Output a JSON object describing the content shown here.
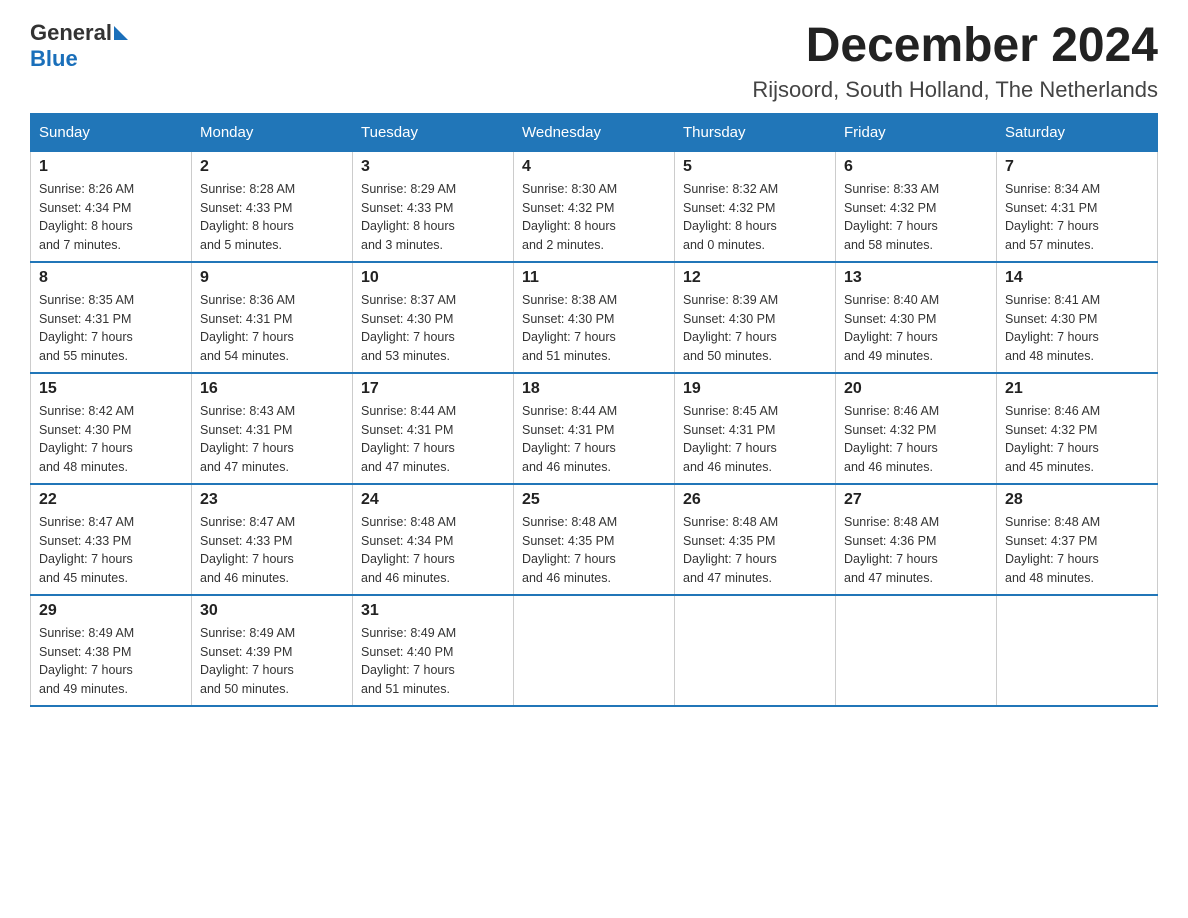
{
  "header": {
    "logo_text_general": "General",
    "logo_text_blue": "Blue",
    "month_title": "December 2024",
    "location": "Rijsoord, South Holland, The Netherlands"
  },
  "days_of_week": [
    "Sunday",
    "Monday",
    "Tuesday",
    "Wednesday",
    "Thursday",
    "Friday",
    "Saturday"
  ],
  "weeks": [
    [
      {
        "day": "1",
        "sunrise": "8:26 AM",
        "sunset": "4:34 PM",
        "daylight": "8 hours and 7 minutes."
      },
      {
        "day": "2",
        "sunrise": "8:28 AM",
        "sunset": "4:33 PM",
        "daylight": "8 hours and 5 minutes."
      },
      {
        "day": "3",
        "sunrise": "8:29 AM",
        "sunset": "4:33 PM",
        "daylight": "8 hours and 3 minutes."
      },
      {
        "day": "4",
        "sunrise": "8:30 AM",
        "sunset": "4:32 PM",
        "daylight": "8 hours and 2 minutes."
      },
      {
        "day": "5",
        "sunrise": "8:32 AM",
        "sunset": "4:32 PM",
        "daylight": "8 hours and 0 minutes."
      },
      {
        "day": "6",
        "sunrise": "8:33 AM",
        "sunset": "4:32 PM",
        "daylight": "7 hours and 58 minutes."
      },
      {
        "day": "7",
        "sunrise": "8:34 AM",
        "sunset": "4:31 PM",
        "daylight": "7 hours and 57 minutes."
      }
    ],
    [
      {
        "day": "8",
        "sunrise": "8:35 AM",
        "sunset": "4:31 PM",
        "daylight": "7 hours and 55 minutes."
      },
      {
        "day": "9",
        "sunrise": "8:36 AM",
        "sunset": "4:31 PM",
        "daylight": "7 hours and 54 minutes."
      },
      {
        "day": "10",
        "sunrise": "8:37 AM",
        "sunset": "4:30 PM",
        "daylight": "7 hours and 53 minutes."
      },
      {
        "day": "11",
        "sunrise": "8:38 AM",
        "sunset": "4:30 PM",
        "daylight": "7 hours and 51 minutes."
      },
      {
        "day": "12",
        "sunrise": "8:39 AM",
        "sunset": "4:30 PM",
        "daylight": "7 hours and 50 minutes."
      },
      {
        "day": "13",
        "sunrise": "8:40 AM",
        "sunset": "4:30 PM",
        "daylight": "7 hours and 49 minutes."
      },
      {
        "day": "14",
        "sunrise": "8:41 AM",
        "sunset": "4:30 PM",
        "daylight": "7 hours and 48 minutes."
      }
    ],
    [
      {
        "day": "15",
        "sunrise": "8:42 AM",
        "sunset": "4:30 PM",
        "daylight": "7 hours and 48 minutes."
      },
      {
        "day": "16",
        "sunrise": "8:43 AM",
        "sunset": "4:31 PM",
        "daylight": "7 hours and 47 minutes."
      },
      {
        "day": "17",
        "sunrise": "8:44 AM",
        "sunset": "4:31 PM",
        "daylight": "7 hours and 47 minutes."
      },
      {
        "day": "18",
        "sunrise": "8:44 AM",
        "sunset": "4:31 PM",
        "daylight": "7 hours and 46 minutes."
      },
      {
        "day": "19",
        "sunrise": "8:45 AM",
        "sunset": "4:31 PM",
        "daylight": "7 hours and 46 minutes."
      },
      {
        "day": "20",
        "sunrise": "8:46 AM",
        "sunset": "4:32 PM",
        "daylight": "7 hours and 46 minutes."
      },
      {
        "day": "21",
        "sunrise": "8:46 AM",
        "sunset": "4:32 PM",
        "daylight": "7 hours and 45 minutes."
      }
    ],
    [
      {
        "day": "22",
        "sunrise": "8:47 AM",
        "sunset": "4:33 PM",
        "daylight": "7 hours and 45 minutes."
      },
      {
        "day": "23",
        "sunrise": "8:47 AM",
        "sunset": "4:33 PM",
        "daylight": "7 hours and 46 minutes."
      },
      {
        "day": "24",
        "sunrise": "8:48 AM",
        "sunset": "4:34 PM",
        "daylight": "7 hours and 46 minutes."
      },
      {
        "day": "25",
        "sunrise": "8:48 AM",
        "sunset": "4:35 PM",
        "daylight": "7 hours and 46 minutes."
      },
      {
        "day": "26",
        "sunrise": "8:48 AM",
        "sunset": "4:35 PM",
        "daylight": "7 hours and 47 minutes."
      },
      {
        "day": "27",
        "sunrise": "8:48 AM",
        "sunset": "4:36 PM",
        "daylight": "7 hours and 47 minutes."
      },
      {
        "day": "28",
        "sunrise": "8:48 AM",
        "sunset": "4:37 PM",
        "daylight": "7 hours and 48 minutes."
      }
    ],
    [
      {
        "day": "29",
        "sunrise": "8:49 AM",
        "sunset": "4:38 PM",
        "daylight": "7 hours and 49 minutes."
      },
      {
        "day": "30",
        "sunrise": "8:49 AM",
        "sunset": "4:39 PM",
        "daylight": "7 hours and 50 minutes."
      },
      {
        "day": "31",
        "sunrise": "8:49 AM",
        "sunset": "4:40 PM",
        "daylight": "7 hours and 51 minutes."
      },
      null,
      null,
      null,
      null
    ]
  ],
  "labels": {
    "sunrise": "Sunrise:",
    "sunset": "Sunset:",
    "daylight": "Daylight:"
  }
}
